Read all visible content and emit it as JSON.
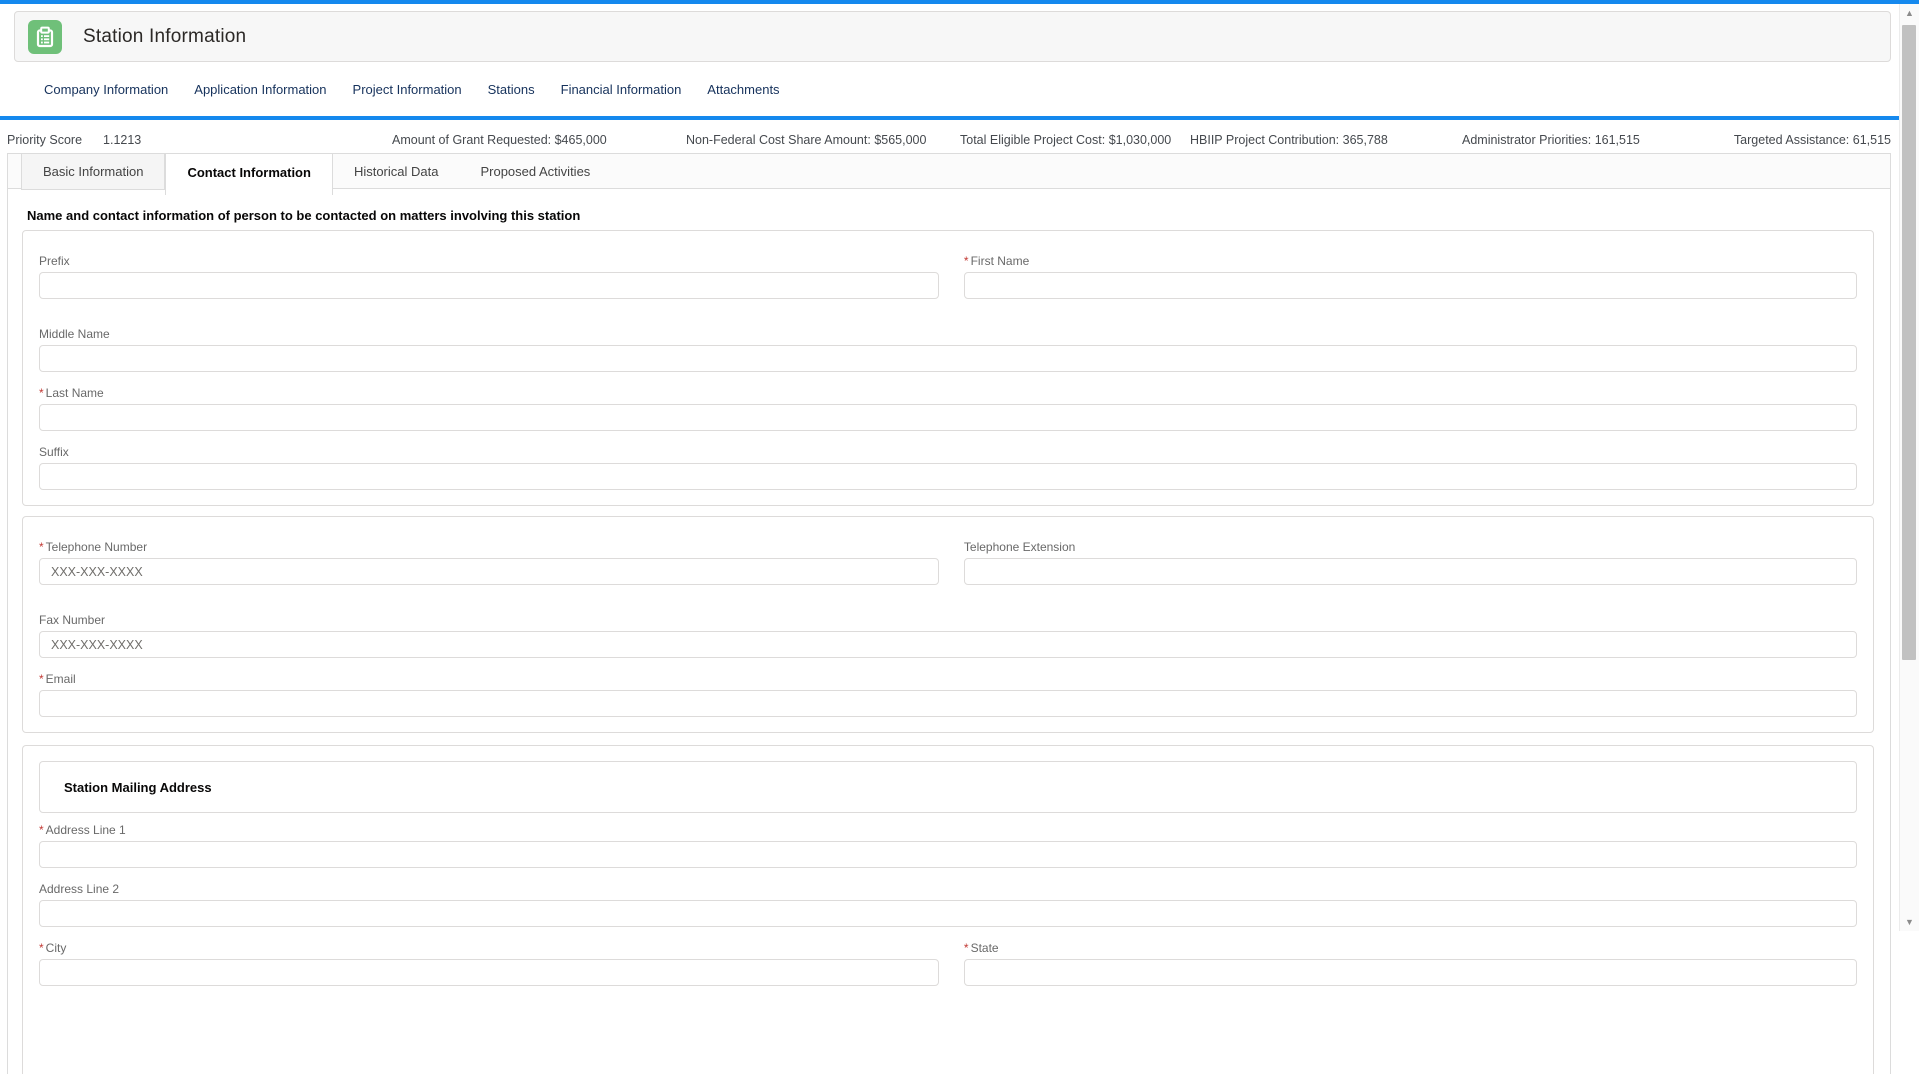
{
  "app": {
    "title": "Station Information",
    "icon": "clipboard-icon"
  },
  "colors": {
    "accent_blue": "#1589ee",
    "icon_green": "#6fc079",
    "required_red": "#c23934"
  },
  "nav_tabs": [
    "Company Information",
    "Application Information",
    "Project Information",
    "Stations",
    "Financial Information",
    "Attachments"
  ],
  "priority_bar": {
    "score_label": "Priority Score",
    "score_value": "1.1213",
    "items": [
      {
        "label": "Amount of Grant Requested:",
        "value": "$465,000"
      },
      {
        "label": "Non-Federal Cost Share Amount:",
        "value": "$565,000"
      },
      {
        "label": "Total Eligible Project Cost:",
        "value": "$1,030,000"
      },
      {
        "label": "HBIIP Project Contribution:",
        "value": "365,788"
      },
      {
        "label": "Administrator Priorities:",
        "value": "161,515"
      },
      {
        "label": "Targeted Assistance:",
        "value": "61,515"
      }
    ]
  },
  "sub_tabs": {
    "basic": "Basic Information",
    "contact": "Contact Information",
    "historical": "Historical Data",
    "proposed": "Proposed Activities",
    "active": "Contact Information"
  },
  "section": {
    "heading": "Name and contact information of person to be contacted on matters involving this station"
  },
  "form": {
    "required_marker": "*",
    "prefix_label": "Prefix",
    "first_name_label": "First Name",
    "middle_name_label": "Middle Name",
    "last_name_label": "Last Name",
    "suffix_label": "Suffix",
    "telephone_label": "Telephone Number",
    "telephone_placeholder": "XXX-XXX-XXXX",
    "extension_label": "Telephone Extension",
    "fax_label": "Fax Number",
    "fax_placeholder": "XXX-XXX-XXXX",
    "email_label": "Email",
    "mailing_address_heading": "Station Mailing Address",
    "address1_label": "Address Line 1",
    "address2_label": "Address Line 2",
    "city_label": "City",
    "state_label": "State"
  },
  "scrollbar": {
    "up_arrow": "▲",
    "down_arrow": "▼"
  }
}
